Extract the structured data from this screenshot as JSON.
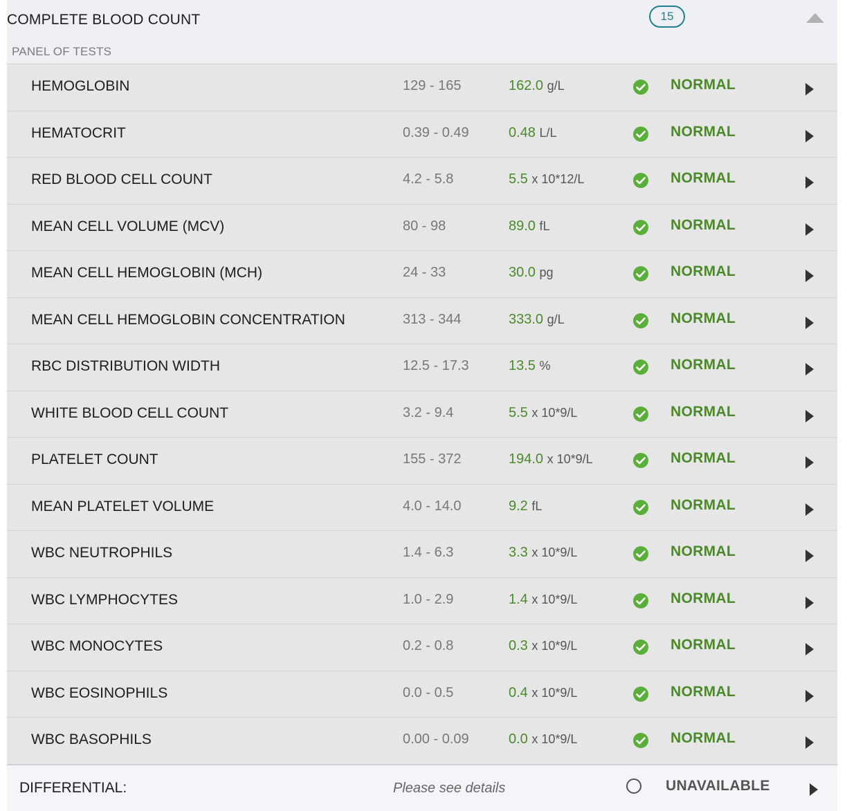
{
  "panel": {
    "title": "COMPLETE BLOOD COUNT",
    "subtitle": "PANEL OF TESTS",
    "count": "15",
    "collapse_icon": "triangle-up-icon"
  },
  "colors": {
    "normal_green": "#4a8a2a",
    "badge_teal": "#1f7f8f",
    "check_green": "#5aae3a"
  },
  "tests": [
    {
      "name": "HEMOGLOBIN",
      "range": "129 - 165",
      "value": "162.0",
      "unit": "g/L",
      "status": "NORMAL"
    },
    {
      "name": "HEMATOCRIT",
      "range": "0.39 - 0.49",
      "value": "0.48",
      "unit": "L/L",
      "status": "NORMAL"
    },
    {
      "name": "RED BLOOD CELL COUNT",
      "range": "4.2 - 5.8",
      "value": "5.5",
      "unit": "x 10*12/L",
      "status": "NORMAL"
    },
    {
      "name": "MEAN CELL VOLUME (MCV)",
      "range": "80 - 98",
      "value": "89.0",
      "unit": "fL",
      "status": "NORMAL"
    },
    {
      "name": "MEAN CELL HEMOGLOBIN (MCH)",
      "range": "24 - 33",
      "value": "30.0",
      "unit": "pg",
      "status": "NORMAL"
    },
    {
      "name": "MEAN CELL HEMOGLOBIN CONCENTRATION",
      "range": "313 - 344",
      "value": "333.0",
      "unit": "g/L",
      "status": "NORMAL"
    },
    {
      "name": "RBC DISTRIBUTION WIDTH",
      "range": "12.5 - 17.3",
      "value": "13.5",
      "unit": "%",
      "status": "NORMAL"
    },
    {
      "name": "WHITE BLOOD CELL COUNT",
      "range": "3.2 - 9.4",
      "value": "5.5",
      "unit": "x 10*9/L",
      "status": "NORMAL"
    },
    {
      "name": "PLATELET COUNT",
      "range": "155 - 372",
      "value": "194.0",
      "unit": "x 10*9/L",
      "status": "NORMAL"
    },
    {
      "name": "MEAN PLATELET VOLUME",
      "range": "4.0 - 14.0",
      "value": "9.2",
      "unit": "fL",
      "status": "NORMAL"
    },
    {
      "name": "WBC NEUTROPHILS",
      "range": "1.4 - 6.3",
      "value": "3.3",
      "unit": "x 10*9/L",
      "status": "NORMAL"
    },
    {
      "name": "WBC LYMPHOCYTES",
      "range": "1.0 - 2.9",
      "value": "1.4",
      "unit": "x 10*9/L",
      "status": "NORMAL"
    },
    {
      "name": "WBC MONOCYTES",
      "range": "0.2 - 0.8",
      "value": "0.3",
      "unit": "x 10*9/L",
      "status": "NORMAL"
    },
    {
      "name": "WBC EOSINOPHILS",
      "range": "0.0 - 0.5",
      "value": "0.4",
      "unit": "x 10*9/L",
      "status": "NORMAL"
    },
    {
      "name": "WBC BASOPHILS",
      "range": "0.00 - 0.09",
      "value": "0.0",
      "unit": "x 10*9/L",
      "status": "NORMAL"
    }
  ],
  "footer": {
    "name": "DIFFERENTIAL:",
    "note": "Please see details",
    "status": "UNAVAILABLE",
    "status_icon": "empty-circle-icon"
  }
}
